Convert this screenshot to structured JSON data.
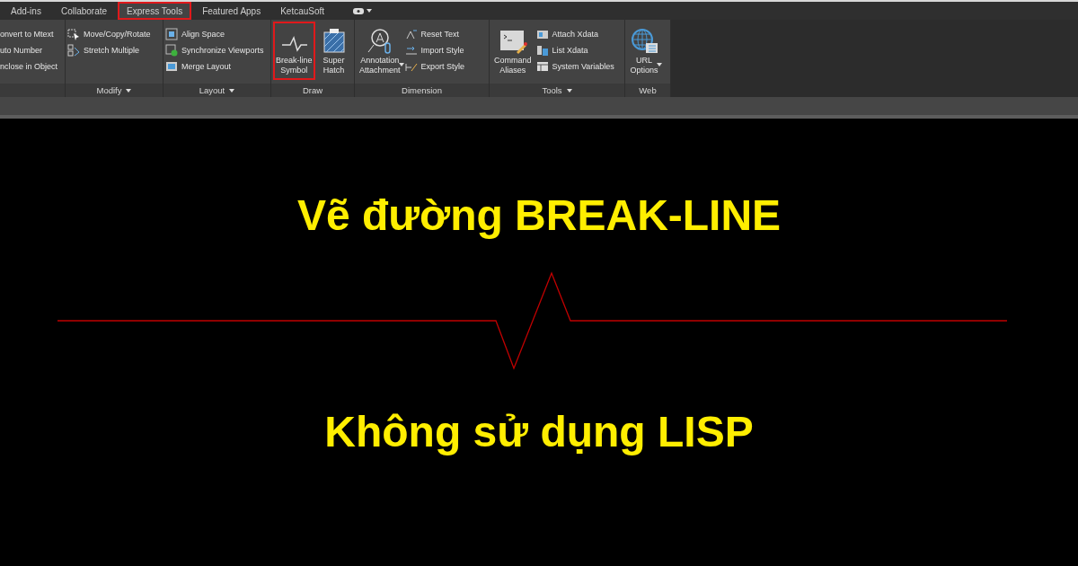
{
  "tabs": [
    {
      "label": "Add-ins",
      "selected": false,
      "highlighted": false
    },
    {
      "label": "Collaborate",
      "selected": false,
      "highlighted": false
    },
    {
      "label": "Express Tools",
      "selected": true,
      "highlighted": true
    },
    {
      "label": "Featured Apps",
      "selected": false,
      "highlighted": false
    },
    {
      "label": "KetcauSoft",
      "selected": false,
      "highlighted": false
    }
  ],
  "panels": [
    {
      "items": [
        {
          "kind": "small",
          "label": "onvert to Mtext"
        },
        {
          "kind": "small",
          "label": "uto Number"
        },
        {
          "kind": "small",
          "label": "nclose in Object"
        }
      ]
    },
    {
      "title": "Modify",
      "has_menu": true,
      "items": [
        {
          "kind": "small",
          "label": "Move/Copy/Rotate"
        },
        {
          "kind": "small",
          "label": "Stretch Multiple"
        }
      ]
    },
    {
      "title": "Layout",
      "has_menu": true,
      "items": [
        {
          "kind": "small",
          "label": "Align Space"
        },
        {
          "kind": "small",
          "label": "Synchronize Viewports"
        },
        {
          "kind": "small",
          "label": "Merge Layout"
        }
      ]
    },
    {
      "title": "Draw",
      "has_menu": false,
      "items": [
        {
          "kind": "large",
          "label_lines": [
            "Break-line",
            "Symbol"
          ],
          "has_menu": false,
          "highlighted": true
        },
        {
          "kind": "large",
          "label_lines": [
            "Super",
            "Hatch"
          ],
          "has_menu": false,
          "highlighted": false
        }
      ]
    },
    {
      "title": "Dimension",
      "has_menu": false,
      "items": [
        {
          "kind": "large",
          "label_lines": [
            "Annotation",
            "Attachment"
          ],
          "has_menu": true,
          "highlighted": false
        },
        {
          "kind": "small",
          "label": "Reset Text"
        },
        {
          "kind": "small",
          "label": "Import Style"
        },
        {
          "kind": "small",
          "label": "Export Style"
        }
      ]
    },
    {
      "title": "Tools",
      "has_menu": true,
      "items": [
        {
          "kind": "large",
          "label_lines": [
            "Command",
            "Aliases"
          ],
          "has_menu": false,
          "highlighted": false
        },
        {
          "kind": "small",
          "label": "Attach Xdata"
        },
        {
          "kind": "small",
          "label": "List Xdata"
        },
        {
          "kind": "small",
          "label": "System Variables"
        }
      ]
    },
    {
      "title": "Web",
      "has_menu": false,
      "items": [
        {
          "kind": "large",
          "label_lines": [
            "URL",
            "Options"
          ],
          "has_menu": true,
          "highlighted": false
        }
      ]
    }
  ],
  "canvas": {
    "title": "Vẽ đường BREAK-LINE",
    "subtitle": "Không sử dụng LISP"
  }
}
